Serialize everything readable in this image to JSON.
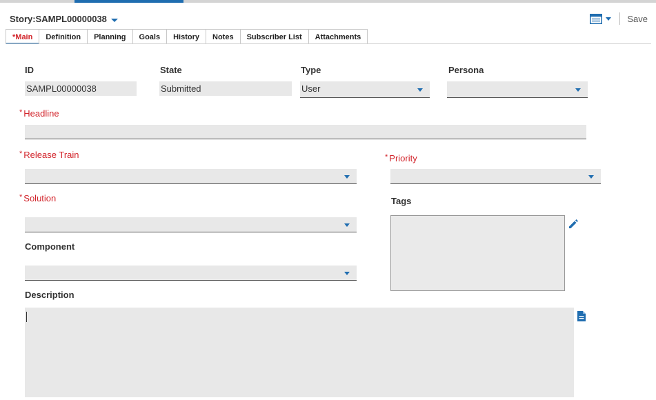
{
  "header": {
    "story_title": "Story:SAMPL00000038",
    "save_label": "Save"
  },
  "tabs": [
    {
      "label": "*Main",
      "active": true
    },
    {
      "label": "Definition"
    },
    {
      "label": "Planning"
    },
    {
      "label": "Goals"
    },
    {
      "label": "History"
    },
    {
      "label": "Notes"
    },
    {
      "label": "Subscriber List"
    },
    {
      "label": "Attachments"
    }
  ],
  "form": {
    "id": {
      "label": "ID",
      "value": "SAMPL00000038"
    },
    "state": {
      "label": "State",
      "value": "Submitted"
    },
    "type": {
      "label": "Type",
      "value": "User"
    },
    "persona": {
      "label": "Persona",
      "value": ""
    },
    "headline": {
      "label": "Headline",
      "required_mark": "*",
      "value": ""
    },
    "release_train": {
      "label": "Release Train",
      "required_mark": "*",
      "value": ""
    },
    "priority": {
      "label": "Priority",
      "required_mark": "*",
      "value": ""
    },
    "solution": {
      "label": "Solution",
      "required_mark": "*",
      "value": ""
    },
    "tags": {
      "label": "Tags",
      "value": ""
    },
    "component": {
      "label": "Component",
      "value": ""
    },
    "description": {
      "label": "Description",
      "value": ""
    }
  },
  "colors": {
    "accent": "#1f6db0",
    "required": "#d2232a",
    "field_bg": "#e8e8e8"
  },
  "icons": {
    "calendar": "calendar-icon",
    "edit_tags": "pencil-icon",
    "description_doc": "document-icon"
  }
}
